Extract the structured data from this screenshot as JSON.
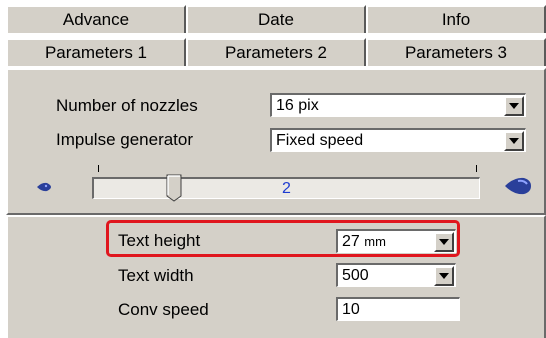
{
  "tabs_row1": [
    "Advance",
    "Date",
    "Info"
  ],
  "tabs_row2": [
    "Parameters 1",
    "Parameters 2",
    "Parameters 3"
  ],
  "params": {
    "nozzles_label": "Number of nozzles",
    "nozzles_value": "16 pix",
    "impulse_label": "Impulse generator",
    "impulse_value": "Fixed speed",
    "slider_value": "2",
    "slider_min_icon": "small-drop-icon",
    "slider_max_icon": "large-drop-icon"
  },
  "text": {
    "height_label": "Text height",
    "height_value": "27",
    "height_unit": "mm",
    "width_label": "Text width",
    "width_value": "500",
    "conv_label": "Conv speed",
    "conv_value": "10"
  },
  "colors": {
    "panel": "#d4d0c8",
    "highlight": "#e0161e",
    "slider_text": "#1e3cd0",
    "drop_icon": "#2a3f9a"
  }
}
